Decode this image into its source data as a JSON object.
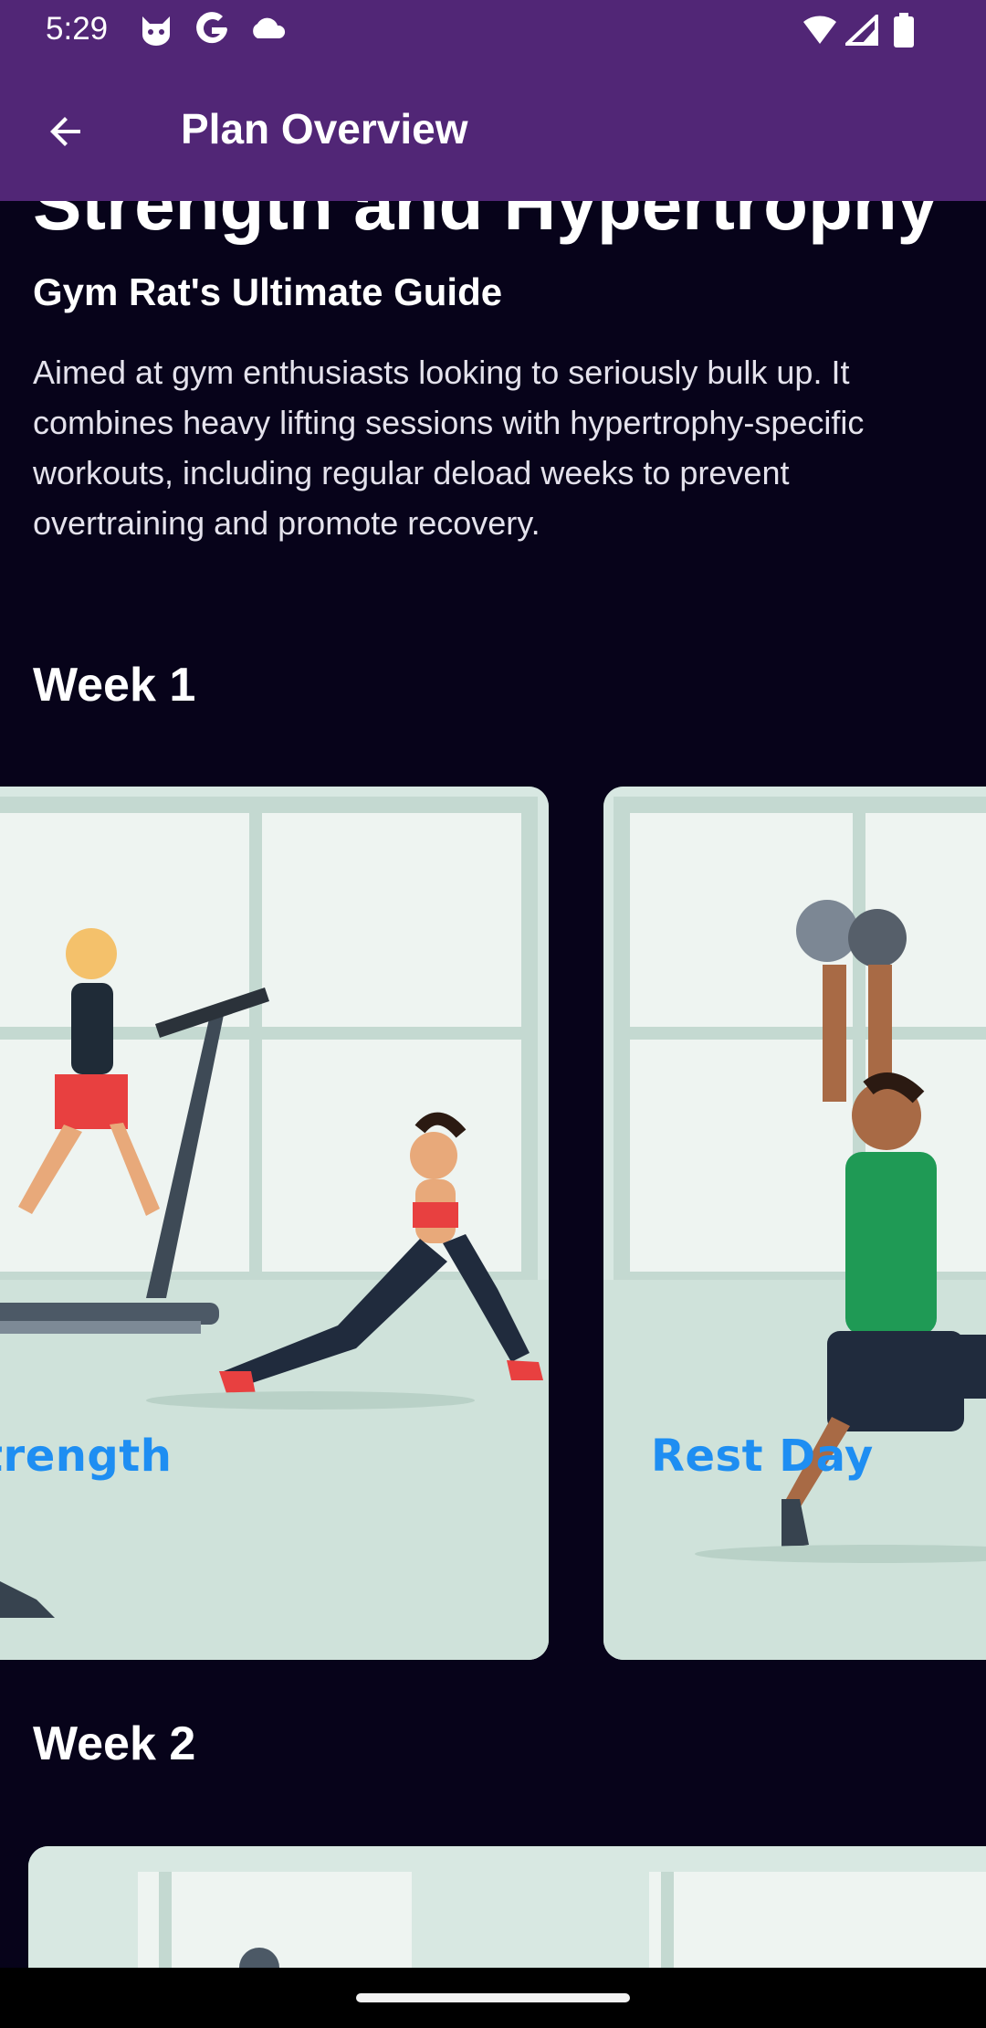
{
  "status_bar": {
    "time": "5:29",
    "left_icons": [
      "cat-notification-icon",
      "google-icon",
      "cloud-icon"
    ],
    "right_icons": [
      "wifi-icon",
      "signal-icon",
      "battery-icon"
    ]
  },
  "app_bar": {
    "back_icon": "arrow-left-icon",
    "title": "Plan Overview"
  },
  "plan": {
    "title": "Strength and Hypertrophy",
    "subtitle": "Gym Rat's Ultimate Guide",
    "description": "Aimed at gym enthusiasts looking to seriously bulk up. It combines heavy lifting sessions with hypertrophy-specific workouts, including regular deload weeks to prevent overtraining and promote recovery."
  },
  "weeks": [
    {
      "label": "Week 1",
      "days": [
        {
          "label": "Strength",
          "image": "gym-cardio-lunge-illustration"
        },
        {
          "label": "Rest Day",
          "image": "dumbbell-lunge-illustration"
        }
      ]
    },
    {
      "label": "Week 2",
      "days": [
        {
          "label": "",
          "image": "gym-illustration"
        }
      ]
    }
  ],
  "colors": {
    "app_bar": "#512676",
    "background": "#07031a",
    "card_label": "#1e8ef2",
    "card_bg": "#d5e6df"
  }
}
